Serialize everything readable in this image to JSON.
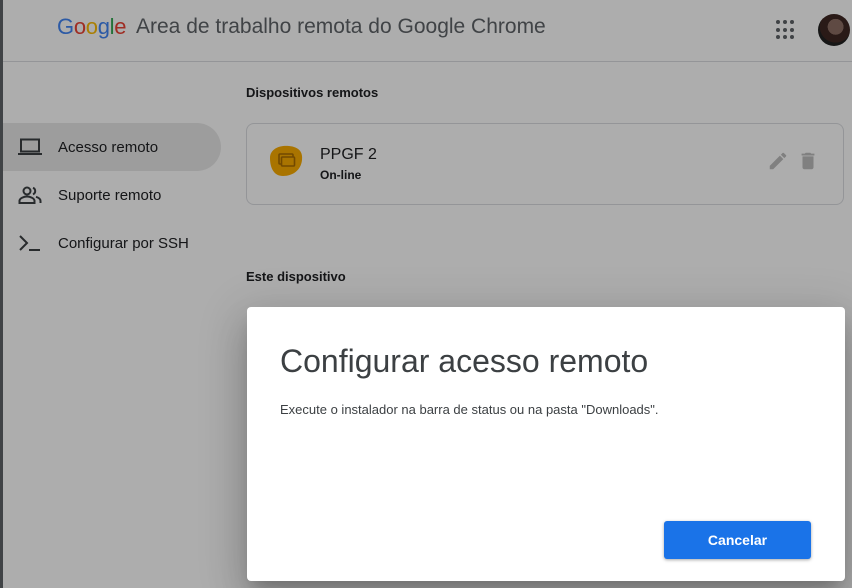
{
  "header": {
    "logo_text": "Google",
    "title": "Area de trabalho remota do Google Chrome",
    "apps_icon": "apps-grid-icon",
    "avatar_icon": "user-avatar"
  },
  "sidebar": {
    "items": [
      {
        "label": "Acesso remoto",
        "icon": "laptop-icon",
        "active": true
      },
      {
        "label": "Suporte remoto",
        "icon": "people-icon",
        "active": false
      },
      {
        "label": "Configurar por SSH",
        "icon": "terminal-icon",
        "active": false
      }
    ]
  },
  "main": {
    "remote_devices_title": "Dispositivos remotos",
    "device": {
      "name": "PPGF 2",
      "status": "On-line",
      "icon": "remote-computer-icon",
      "edit_icon": "pencil-icon",
      "delete_icon": "trash-icon"
    },
    "this_device_title": "Este dispositivo"
  },
  "dialog": {
    "title": "Configurar acesso remoto",
    "body": "Execute o instalador na barra de status ou na pasta \"Downloads\".",
    "cancel_label": "Cancelar"
  },
  "colors": {
    "accent": "#1a73e8",
    "device_icon": "#f9ab00",
    "google_blue": "#4285f4",
    "google_red": "#ea4335",
    "google_yellow": "#fbbc05",
    "google_green": "#34a853"
  }
}
